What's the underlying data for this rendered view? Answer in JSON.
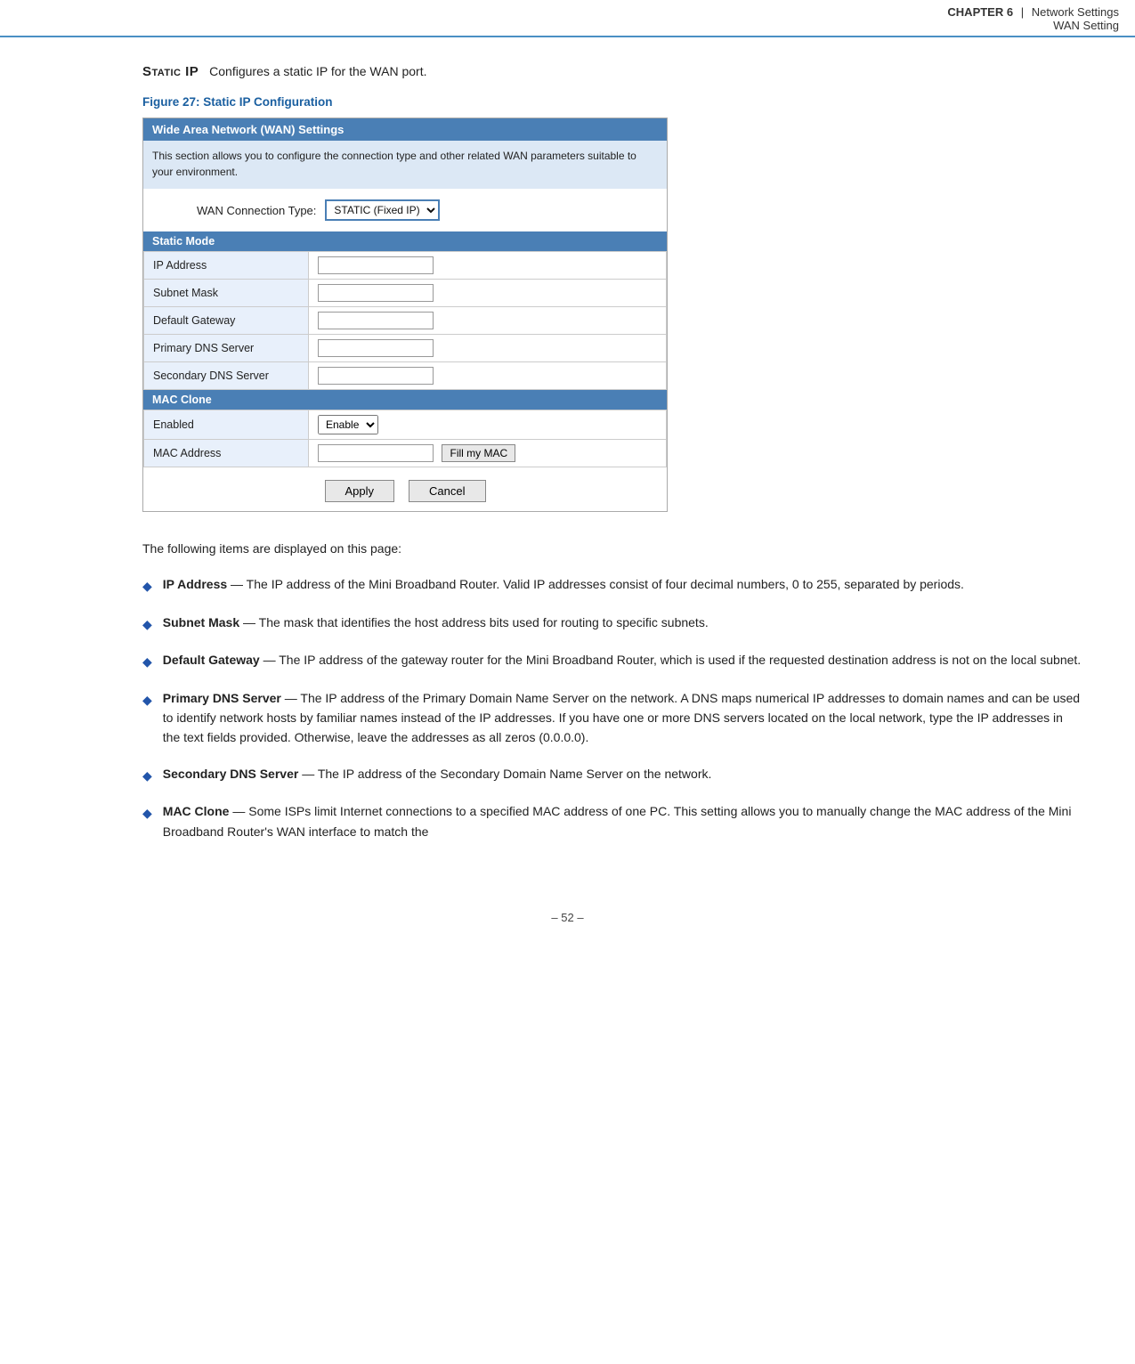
{
  "header": {
    "chapter": "CHAPTER 6",
    "divider": "|",
    "title": "Network Settings",
    "subtitle": "WAN Setting"
  },
  "static_ip_section": {
    "label": "Static IP",
    "description": "Configures a static IP for the WAN port."
  },
  "figure": {
    "title": "Figure 27:  Static IP Configuration"
  },
  "wan_box": {
    "header": "Wide Area Network (WAN) Settings",
    "description": "This section allows you to configure the connection type and other related WAN parameters\nsuitable to your environment.",
    "connection_type_label": "WAN Connection Type:",
    "connection_type_value": "STATIC (Fixed IP)",
    "sections": [
      {
        "name": "Static Mode",
        "fields": [
          {
            "label": "IP Address",
            "type": "text"
          },
          {
            "label": "Subnet Mask",
            "type": "text"
          },
          {
            "label": "Default Gateway",
            "type": "text"
          },
          {
            "label": "Primary DNS Server",
            "type": "text"
          },
          {
            "label": "Secondary DNS Server",
            "type": "text"
          }
        ]
      },
      {
        "name": "MAC Clone",
        "fields": [
          {
            "label": "Enabled",
            "type": "select",
            "options": [
              "Enable"
            ]
          },
          {
            "label": "MAC Address",
            "type": "text",
            "extra_button": "Fill my MAC"
          }
        ]
      }
    ],
    "apply_label": "Apply",
    "cancel_label": "Cancel"
  },
  "desc_intro": "The following items are displayed on this page:",
  "bullets": [
    {
      "term": "IP Address",
      "text": "— The IP address of the Mini Broadband Router. Valid IP addresses consist of four decimal numbers, 0 to 255, separated by periods."
    },
    {
      "term": "Subnet Mask",
      "text": "— The mask that identifies the host address bits used for routing to specific subnets."
    },
    {
      "term": "Default Gateway",
      "text": "— The IP address of the gateway router for the Mini Broadband Router, which is used if the requested destination address is not on the local subnet."
    },
    {
      "term": "Primary DNS Server",
      "text": "— The IP address of the Primary Domain Name Server on the network. A DNS maps numerical IP addresses to domain names and can be used to identify network hosts by familiar names instead of the IP addresses. If you have one or more DNS servers located on the local network, type the IP addresses in the text fields provided. Otherwise, leave the addresses as all zeros (0.0.0.0)."
    },
    {
      "term": "Secondary DNS Server",
      "text": "— The IP address of the Secondary Domain Name Server on the network."
    },
    {
      "term": "MAC Clone",
      "text": "— Some ISPs limit Internet connections to a specified MAC address of one PC. This setting allows you to manually change the MAC address of the Mini Broadband Router's WAN interface to match the"
    }
  ],
  "footer": {
    "text": "–  52  –"
  }
}
